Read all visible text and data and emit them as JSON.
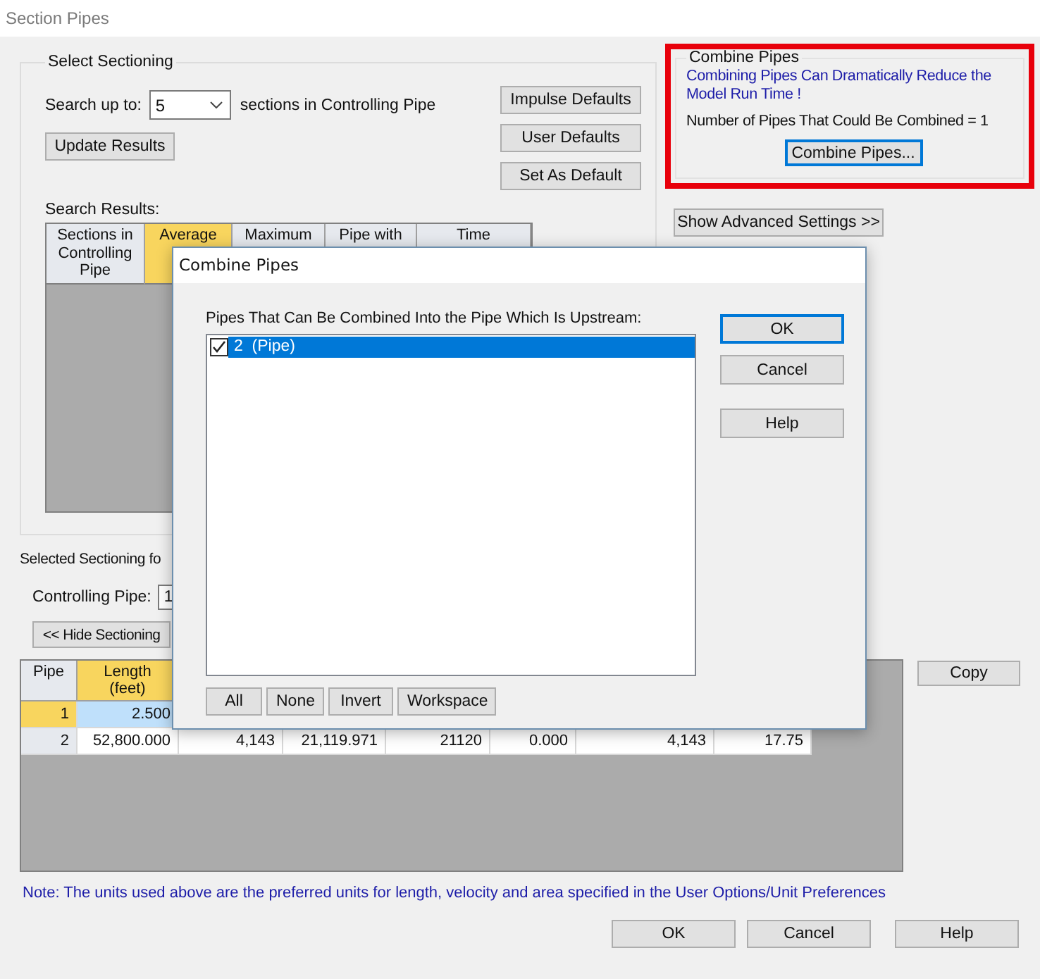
{
  "window": {
    "title": "Section Pipes"
  },
  "select_sectioning": {
    "title": "Select Sectioning",
    "search_label": "Search up to:",
    "search_value": "5",
    "search_suffix": "sections in Controlling Pipe",
    "update_button": "Update Results",
    "default_buttons": [
      "Impulse Defaults",
      "User Defaults",
      "Set As Default"
    ],
    "results_label": "Search Results:",
    "results_columns": [
      {
        "lines": [
          "Sections in",
          "Controlling",
          "Pipe"
        ],
        "selected": false
      },
      {
        "lines": [
          "Average"
        ],
        "selected": true
      },
      {
        "lines": [
          "Maximum"
        ],
        "selected": false
      },
      {
        "lines": [
          "Pipe with"
        ],
        "selected": false
      },
      {
        "lines": [
          "Time"
        ],
        "selected": false
      }
    ]
  },
  "combine_group": {
    "title": "Combine Pipes",
    "highlighted": true,
    "message": "Combining Pipes Can Dramatically Reduce the Model Run Time !",
    "count_text": "Number of Pipes That Could Be Combined = 1",
    "button": "Combine Pipes...",
    "button_focused": true
  },
  "advanced_button": "Show Advanced Settings >>",
  "selected_sectioning": {
    "title": "Selected Sectioning fo",
    "controlling_label": "Controlling Pipe:",
    "controlling_value": "1",
    "hide_button": "<< Hide Sectioning"
  },
  "copy_button": "Copy",
  "pipe_table": {
    "columns": [
      {
        "lines": [
          "Pipe"
        ],
        "selected": false
      },
      {
        "lines": [
          "Length",
          "(feet)"
        ],
        "selected": true
      }
    ],
    "rows": [
      {
        "selected": true,
        "cells": [
          "1",
          "2.500"
        ]
      },
      {
        "selected": false,
        "cells": [
          "2",
          "52,800.000",
          "4,143",
          "21,119.971",
          "21120",
          "0.000",
          "4,143",
          "17.75"
        ]
      }
    ]
  },
  "note": "Note: The units used above are the preferred units for length, velocity and area specified in the User Options/Unit Preferences",
  "buttons": [
    "OK",
    "Cancel",
    "Help"
  ],
  "dialog": {
    "title": "Combine Pipes",
    "list_label": "Pipes That Can Be Combined Into the Pipe Which Is Upstream:",
    "items": [
      {
        "label": "2  (Pipe)",
        "checked": true,
        "selected": true
      }
    ],
    "list_buttons": [
      "All",
      "None",
      "Invert",
      "Workspace"
    ],
    "buttons": [
      {
        "label": "OK",
        "default": true
      },
      {
        "label": "Cancel",
        "default": false
      },
      {
        "label": "Help",
        "default": false
      }
    ]
  }
}
